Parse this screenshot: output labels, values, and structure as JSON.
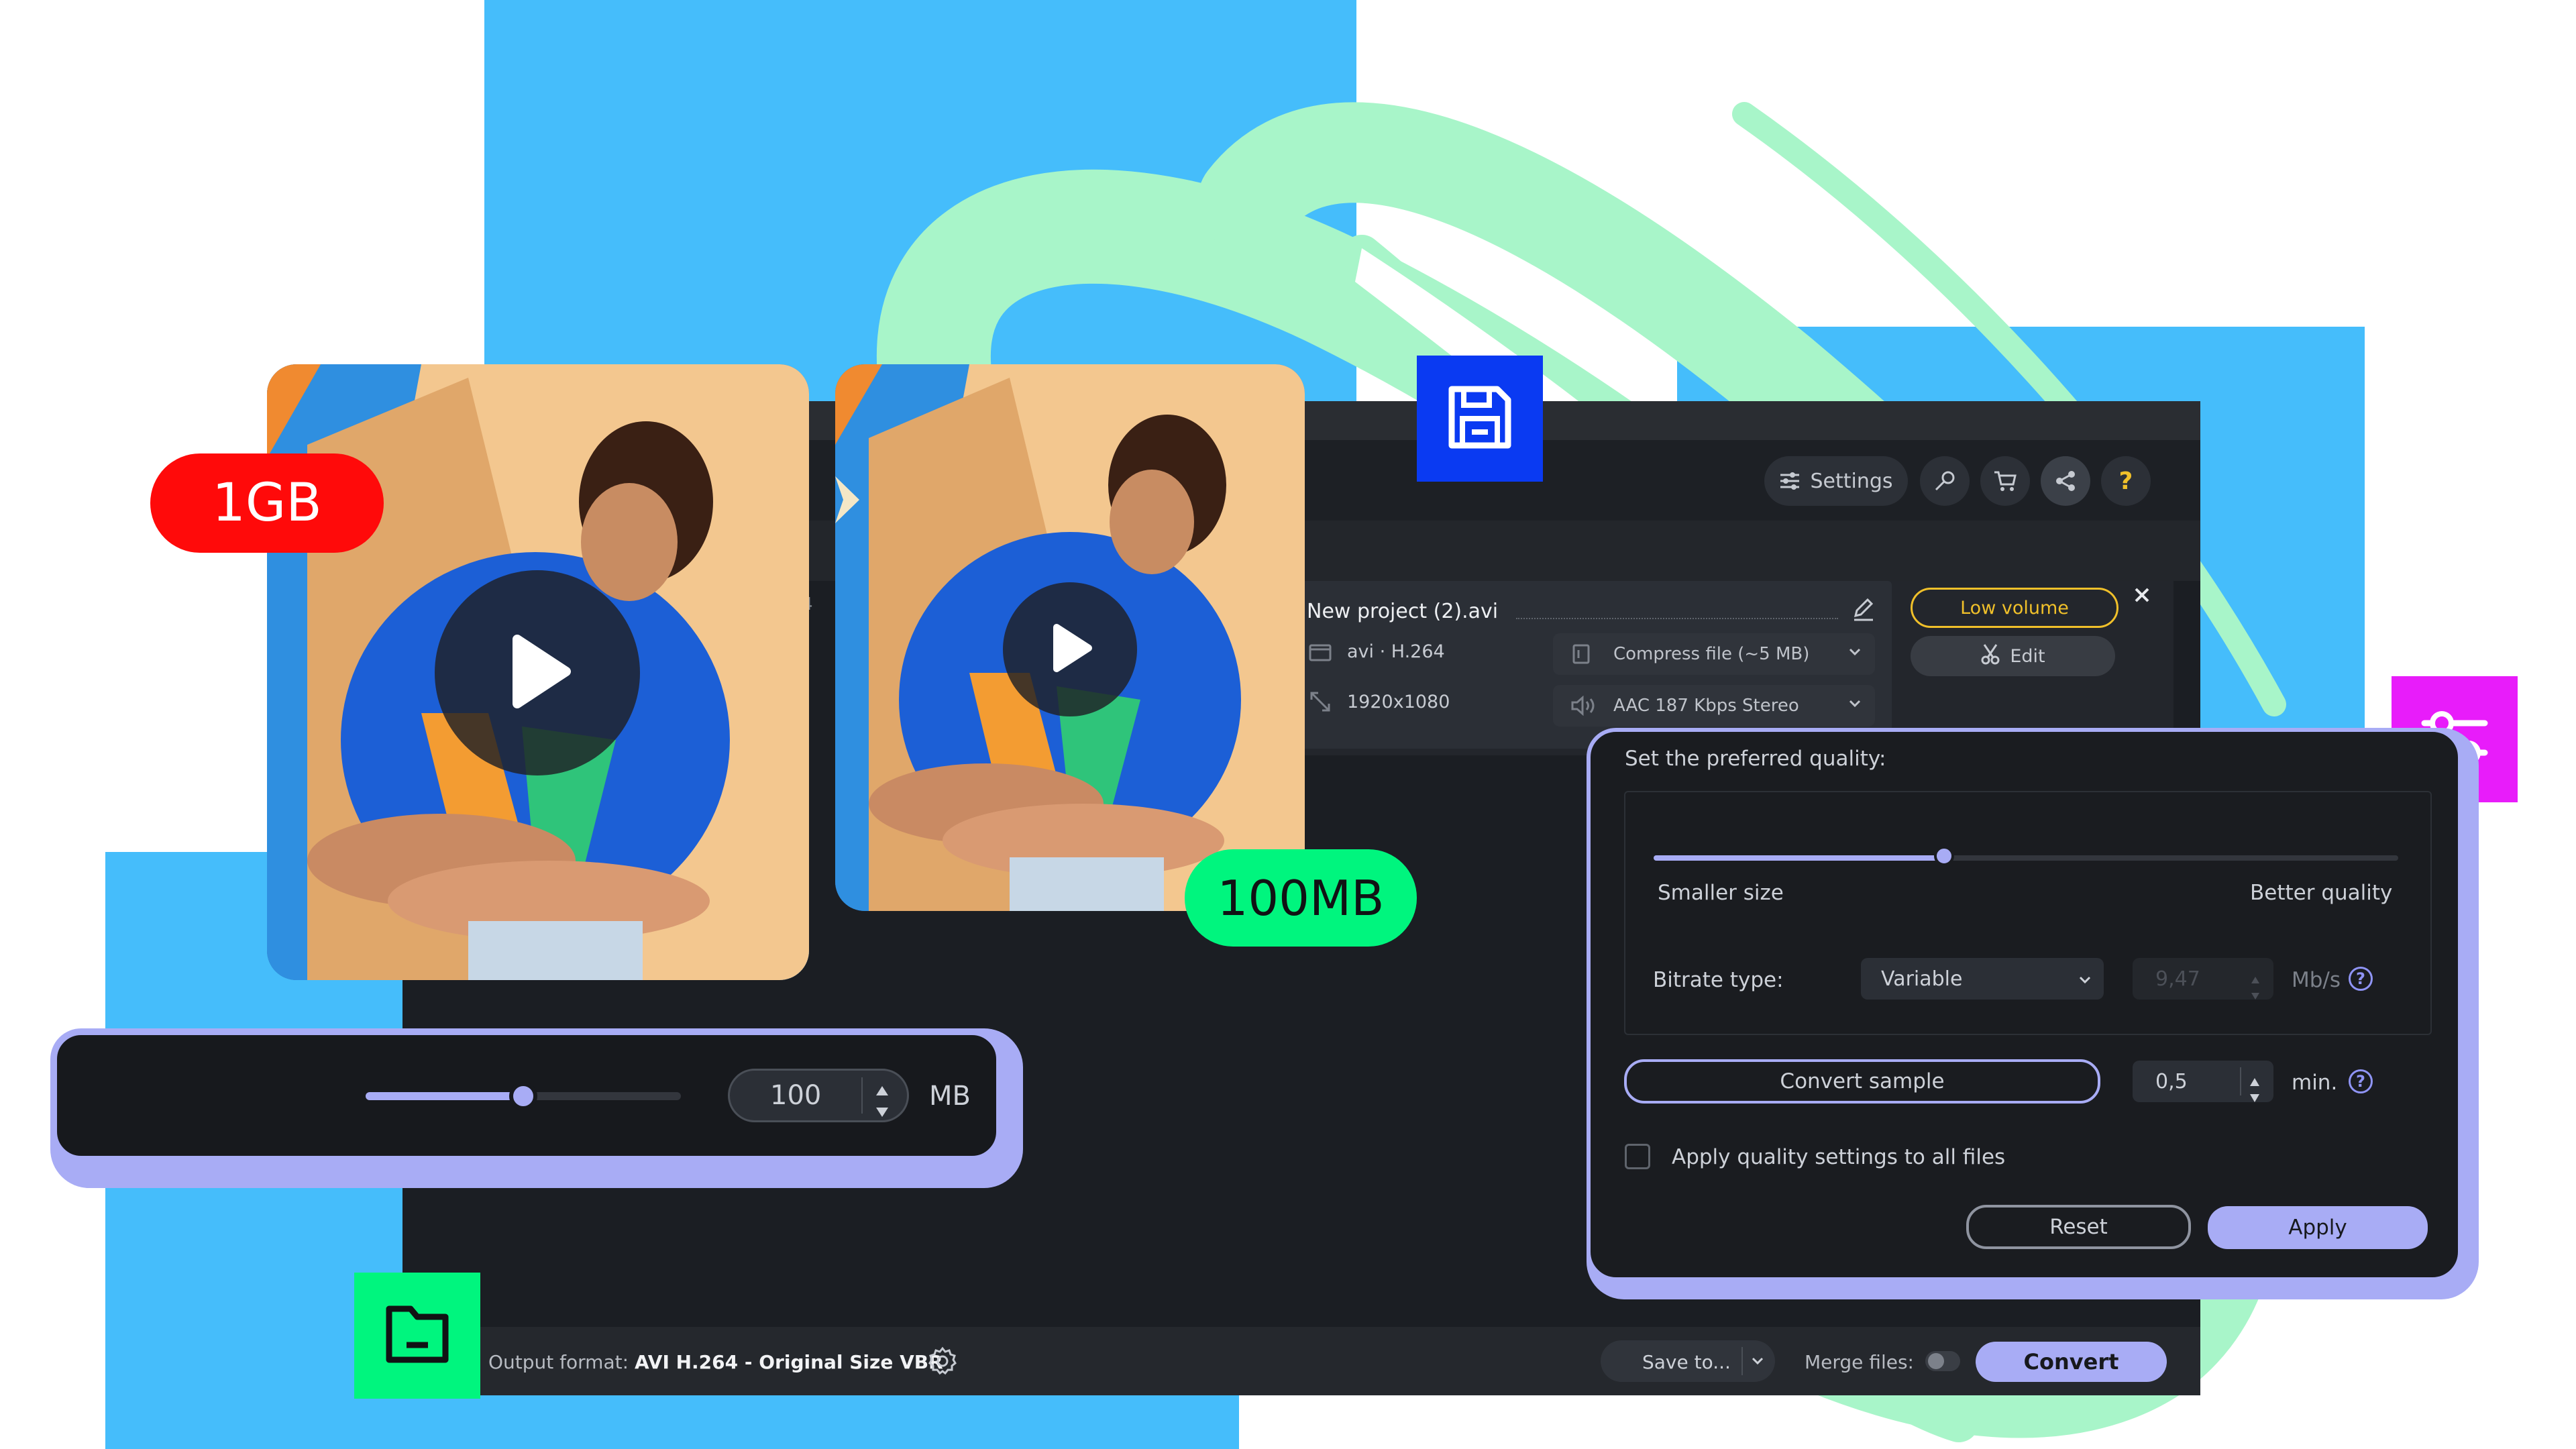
{
  "badges": {
    "original_size": "1GB",
    "compressed_size": "100MB"
  },
  "colors": {
    "blue_background": "#45bdfb",
    "mint_stroke": "#a8f5c9",
    "accent_lavender": "#a8acf5",
    "red_badge": "#ff0a0a",
    "green_badge": "#00f57e",
    "save_tile": "#0a3af2",
    "settings_tile": "#e81cfa",
    "folder_tile": "#00f57e",
    "low_volume_yellow": "#f0c02a"
  },
  "toolbar": {
    "settings_label": "Settings",
    "icons": [
      "sliders-icon",
      "key-icon",
      "cart-icon",
      "share-icon",
      "help-icon"
    ]
  },
  "file": {
    "name": "New project (2).avi",
    "format": "avi · H.264",
    "resolution": "1920x1080",
    "compress_option": "Compress file (~5 MB)",
    "audio_option": "AAC 187 Kbps Stereo",
    "low_volume_label": "Low volume",
    "edit_label": "Edit",
    "left_cut_text_1": "4",
    "left_cut_text_2": ")"
  },
  "quality_dialog": {
    "title": "Set the preferred quality:",
    "slider_level": 0.39,
    "smaller_label": "Smaller size",
    "better_label": "Better quality",
    "bitrate_label": "Bitrate type:",
    "bitrate_value": "Variable",
    "bitrate_number": "9,47",
    "bitrate_unit": "Mb/s",
    "convert_sample_label": "Convert sample",
    "sample_length": "0,5",
    "sample_unit": "min.",
    "apply_all_label": "Apply quality settings to all files",
    "apply_all_checked": false,
    "reset_label": "Reset",
    "apply_label": "Apply"
  },
  "size_widget": {
    "slider_level": 0.5,
    "value": "100",
    "unit": "MB"
  },
  "bottom_bar": {
    "output_label": "Output format:",
    "output_value": "AVI H.264 - Original Size VBR",
    "save_to_label": "Save to...",
    "merge_label": "Merge files:",
    "convert_label": "Convert"
  }
}
